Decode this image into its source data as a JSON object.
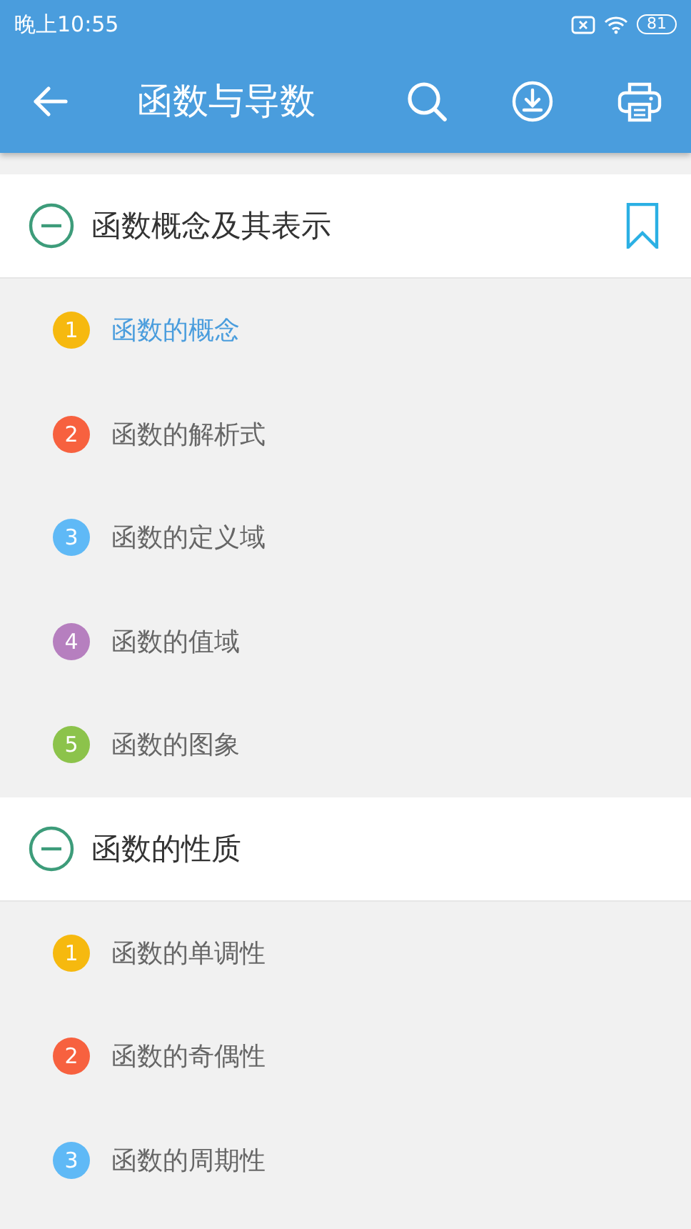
{
  "status_bar": {
    "time": "晚上10:55",
    "battery": "81"
  },
  "app_bar": {
    "title": "函数与导数"
  },
  "sections": [
    {
      "title": "函数概念及其表示",
      "expanded": true,
      "bookmarked": true,
      "items": [
        {
          "number": "1",
          "label": "函数的概念",
          "color": "#f6b90f",
          "selected": true
        },
        {
          "number": "2",
          "label": "函数的解析式",
          "color": "#f7613f",
          "selected": false
        },
        {
          "number": "3",
          "label": "函数的定义域",
          "color": "#5fb9f6",
          "selected": false
        },
        {
          "number": "4",
          "label": "函数的值域",
          "color": "#b67fbf",
          "selected": false
        },
        {
          "number": "5",
          "label": "函数的图象",
          "color": "#8cc34b",
          "selected": false
        }
      ]
    },
    {
      "title": "函数的性质",
      "expanded": true,
      "bookmarked": false,
      "items": [
        {
          "number": "1",
          "label": "函数的单调性",
          "color": "#f6b90f",
          "selected": false
        },
        {
          "number": "2",
          "label": "函数的奇偶性",
          "color": "#f7613f",
          "selected": false
        },
        {
          "number": "3",
          "label": "函数的周期性",
          "color": "#5fb9f6",
          "selected": false
        }
      ]
    }
  ]
}
